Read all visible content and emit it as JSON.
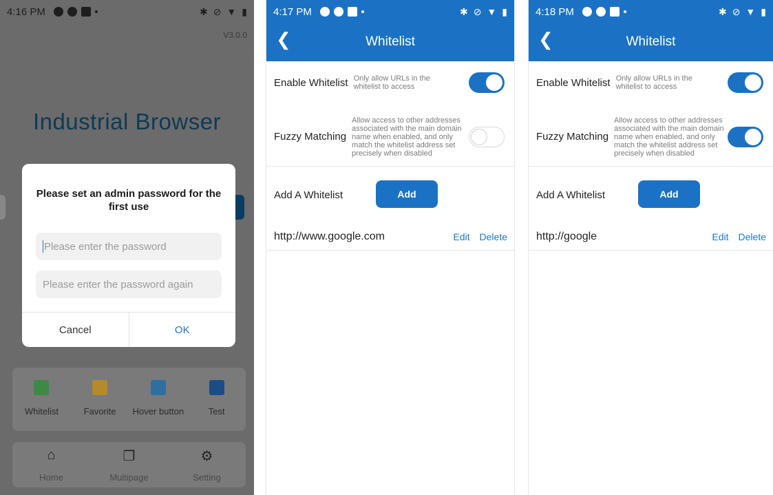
{
  "screen1": {
    "status": {
      "time": "4:16 PM"
    },
    "version": "V3.0.0",
    "app_title": "Industrial Browser",
    "dialog": {
      "title": "Please set an admin password for the first use",
      "password_placeholder": "Please enter the password",
      "password_again_placeholder": "Please enter the password again",
      "cancel_label": "Cancel",
      "ok_label": "OK"
    },
    "tools": [
      {
        "label": "Whitelist",
        "icon": "list-icon",
        "color": "#3d8a47"
      },
      {
        "label": "Favorite",
        "icon": "folder-star-icon",
        "color": "#b48a2a"
      },
      {
        "label": "Hover button",
        "icon": "keyboard-icon",
        "color": "#2f6fa0"
      },
      {
        "label": "Test",
        "icon": "scan-icon",
        "color": "#1c4c86"
      }
    ],
    "nav": [
      {
        "label": "Home",
        "icon": "home-icon"
      },
      {
        "label": "Multipage",
        "icon": "pages-icon"
      },
      {
        "label": "Setting",
        "icon": "gear-icon"
      }
    ]
  },
  "screen2": {
    "status": {
      "time": "4:17 PM"
    },
    "title": "Whitelist",
    "enable": {
      "label": "Enable Whitelist",
      "desc": "Only allow URLs in the whitelist to access",
      "on": true
    },
    "fuzzy": {
      "label": "Fuzzy Matching",
      "desc": "Allow access to other addresses associated with the main domain name when enabled, and only match the whitelist address set precisely when disabled",
      "on": false
    },
    "add": {
      "label": "Add A Whitelist",
      "button": "Add"
    },
    "entries": [
      {
        "url": "http://www.google.com",
        "edit": "Edit",
        "delete": "Delete"
      }
    ]
  },
  "screen3": {
    "status": {
      "time": "4:18 PM"
    },
    "title": "Whitelist",
    "enable": {
      "label": "Enable Whitelist",
      "desc": "Only allow URLs in the whitelist to access",
      "on": true
    },
    "fuzzy": {
      "label": "Fuzzy Matching",
      "desc": "Allow access to other addresses associated with the main domain name when enabled, and only match the whitelist address set precisely when disabled",
      "on": true
    },
    "add": {
      "label": "Add A Whitelist",
      "button": "Add"
    },
    "entries": [
      {
        "url": "http://google",
        "edit": "Edit",
        "delete": "Delete"
      }
    ]
  },
  "colors": {
    "accent": "#1b72c4",
    "link": "#1877c8"
  }
}
